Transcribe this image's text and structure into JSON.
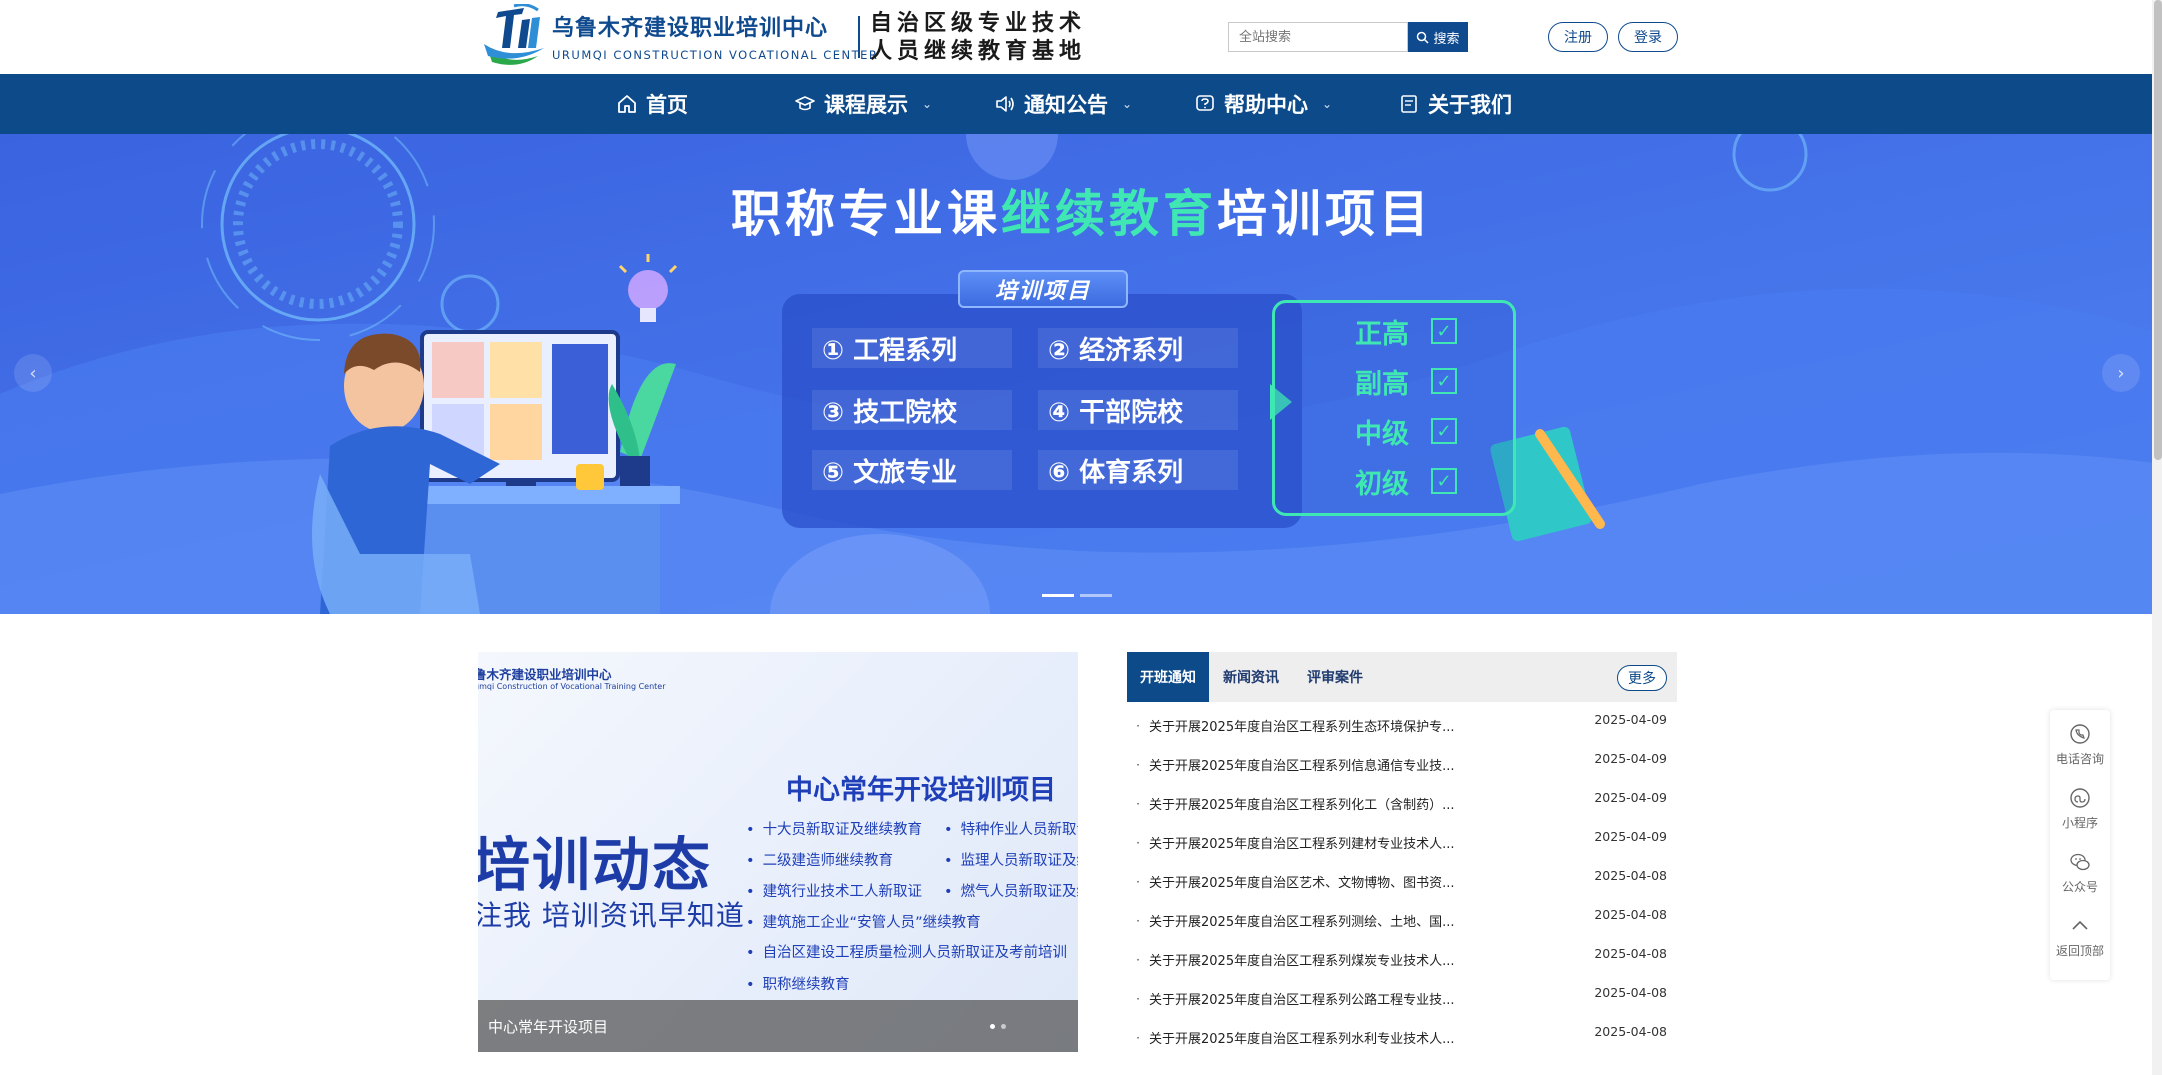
{
  "header": {
    "brand_cn": "乌鲁木齐建设职业培训中心",
    "brand_en": "URUMQI CONSTRUCTION VOCATIONAL CENTER",
    "brand_sub_line1": "自治区级专业技术",
    "brand_sub_line2": "人员继续教育基地",
    "search_placeholder": "全站搜索",
    "search_button": "搜索",
    "register": "注册",
    "login": "登录"
  },
  "nav": [
    {
      "label": "首页",
      "icon": "home-icon"
    },
    {
      "label": "课程展示",
      "icon": "course-icon",
      "dropdown": true
    },
    {
      "label": "通知公告",
      "icon": "speaker-icon",
      "dropdown": true
    },
    {
      "label": "帮助中心",
      "icon": "help-icon",
      "dropdown": true
    },
    {
      "label": "关于我们",
      "icon": "book-icon"
    }
  ],
  "banner": {
    "title_part1": "职称专业课",
    "title_highlight": "继续教育",
    "title_part2": "培训项目",
    "tag": "培训项目",
    "projects": [
      "① 工程系列",
      "② 经济系列",
      "③ 技工院校",
      "④ 干部院校",
      "⑤ 文旅专业",
      "⑥ 体育系列"
    ],
    "levels": [
      "正高",
      "副高",
      "中级",
      "初级"
    ],
    "slides": 2,
    "active_slide": 0,
    "prev": "‹",
    "next": "›",
    "check": "✓"
  },
  "feature": {
    "logo_cn": "鲁木齐建设职业培训中心",
    "logo_en": "umqi Construction of Vocational Training Center",
    "heading": "中心常年开设培训项目",
    "big": "培训动态",
    "sub": "注我 培训资讯早知道",
    "bullets_left": [
      "十大员新取证及继续教育",
      "二级建造师继续教育",
      "建筑行业技术工人新取证",
      "建筑施工企业“安管人员”继续教育",
      "自治区建设工程质量检测人员新取证及考前培训",
      "职称继续教育"
    ],
    "bullets_right": [
      "特种作业人员新取证",
      "监理人员新取证及继",
      "燃气人员新取证及继"
    ],
    "caption": "中心常年开设项目",
    "slides": 2,
    "active_slide": 0
  },
  "news": {
    "tabs": [
      "开班通知",
      "新闻资讯",
      "评审案件"
    ],
    "active_tab": 0,
    "more": "更多",
    "items": [
      {
        "title": "关于开展2025年度自治区工程系列生态环境保护专...",
        "date": "2025-04-09"
      },
      {
        "title": "关于开展2025年度自治区工程系列信息通信专业技...",
        "date": "2025-04-09"
      },
      {
        "title": "关于开展2025年度自治区工程系列化工（含制药）...",
        "date": "2025-04-09"
      },
      {
        "title": "关于开展2025年度自治区工程系列建材专业技术人...",
        "date": "2025-04-09"
      },
      {
        "title": "关于开展2025年度自治区艺术、文物博物、图书资...",
        "date": "2025-04-08"
      },
      {
        "title": "关于开展2025年度自治区工程系列测绘、土地、国...",
        "date": "2025-04-08"
      },
      {
        "title": "关于开展2025年度自治区工程系列煤炭专业技术人...",
        "date": "2025-04-08"
      },
      {
        "title": "关于开展2025年度自治区工程系列公路工程专业技...",
        "date": "2025-04-08"
      },
      {
        "title": "关于开展2025年度自治区工程系列水利专业技术人...",
        "date": "2025-04-08"
      }
    ]
  },
  "side": [
    {
      "label": "电话咨询",
      "icon": "phone-icon"
    },
    {
      "label": "小程序",
      "icon": "mini-program-icon"
    },
    {
      "label": "公众号",
      "icon": "wechat-icon"
    },
    {
      "label": "返回顶部",
      "icon": "arrow-up-icon"
    }
  ],
  "colors": {
    "primary": "#0c4a8a",
    "banner_blue": "#3f6fe8",
    "accent_green": "#3fe8b2"
  }
}
